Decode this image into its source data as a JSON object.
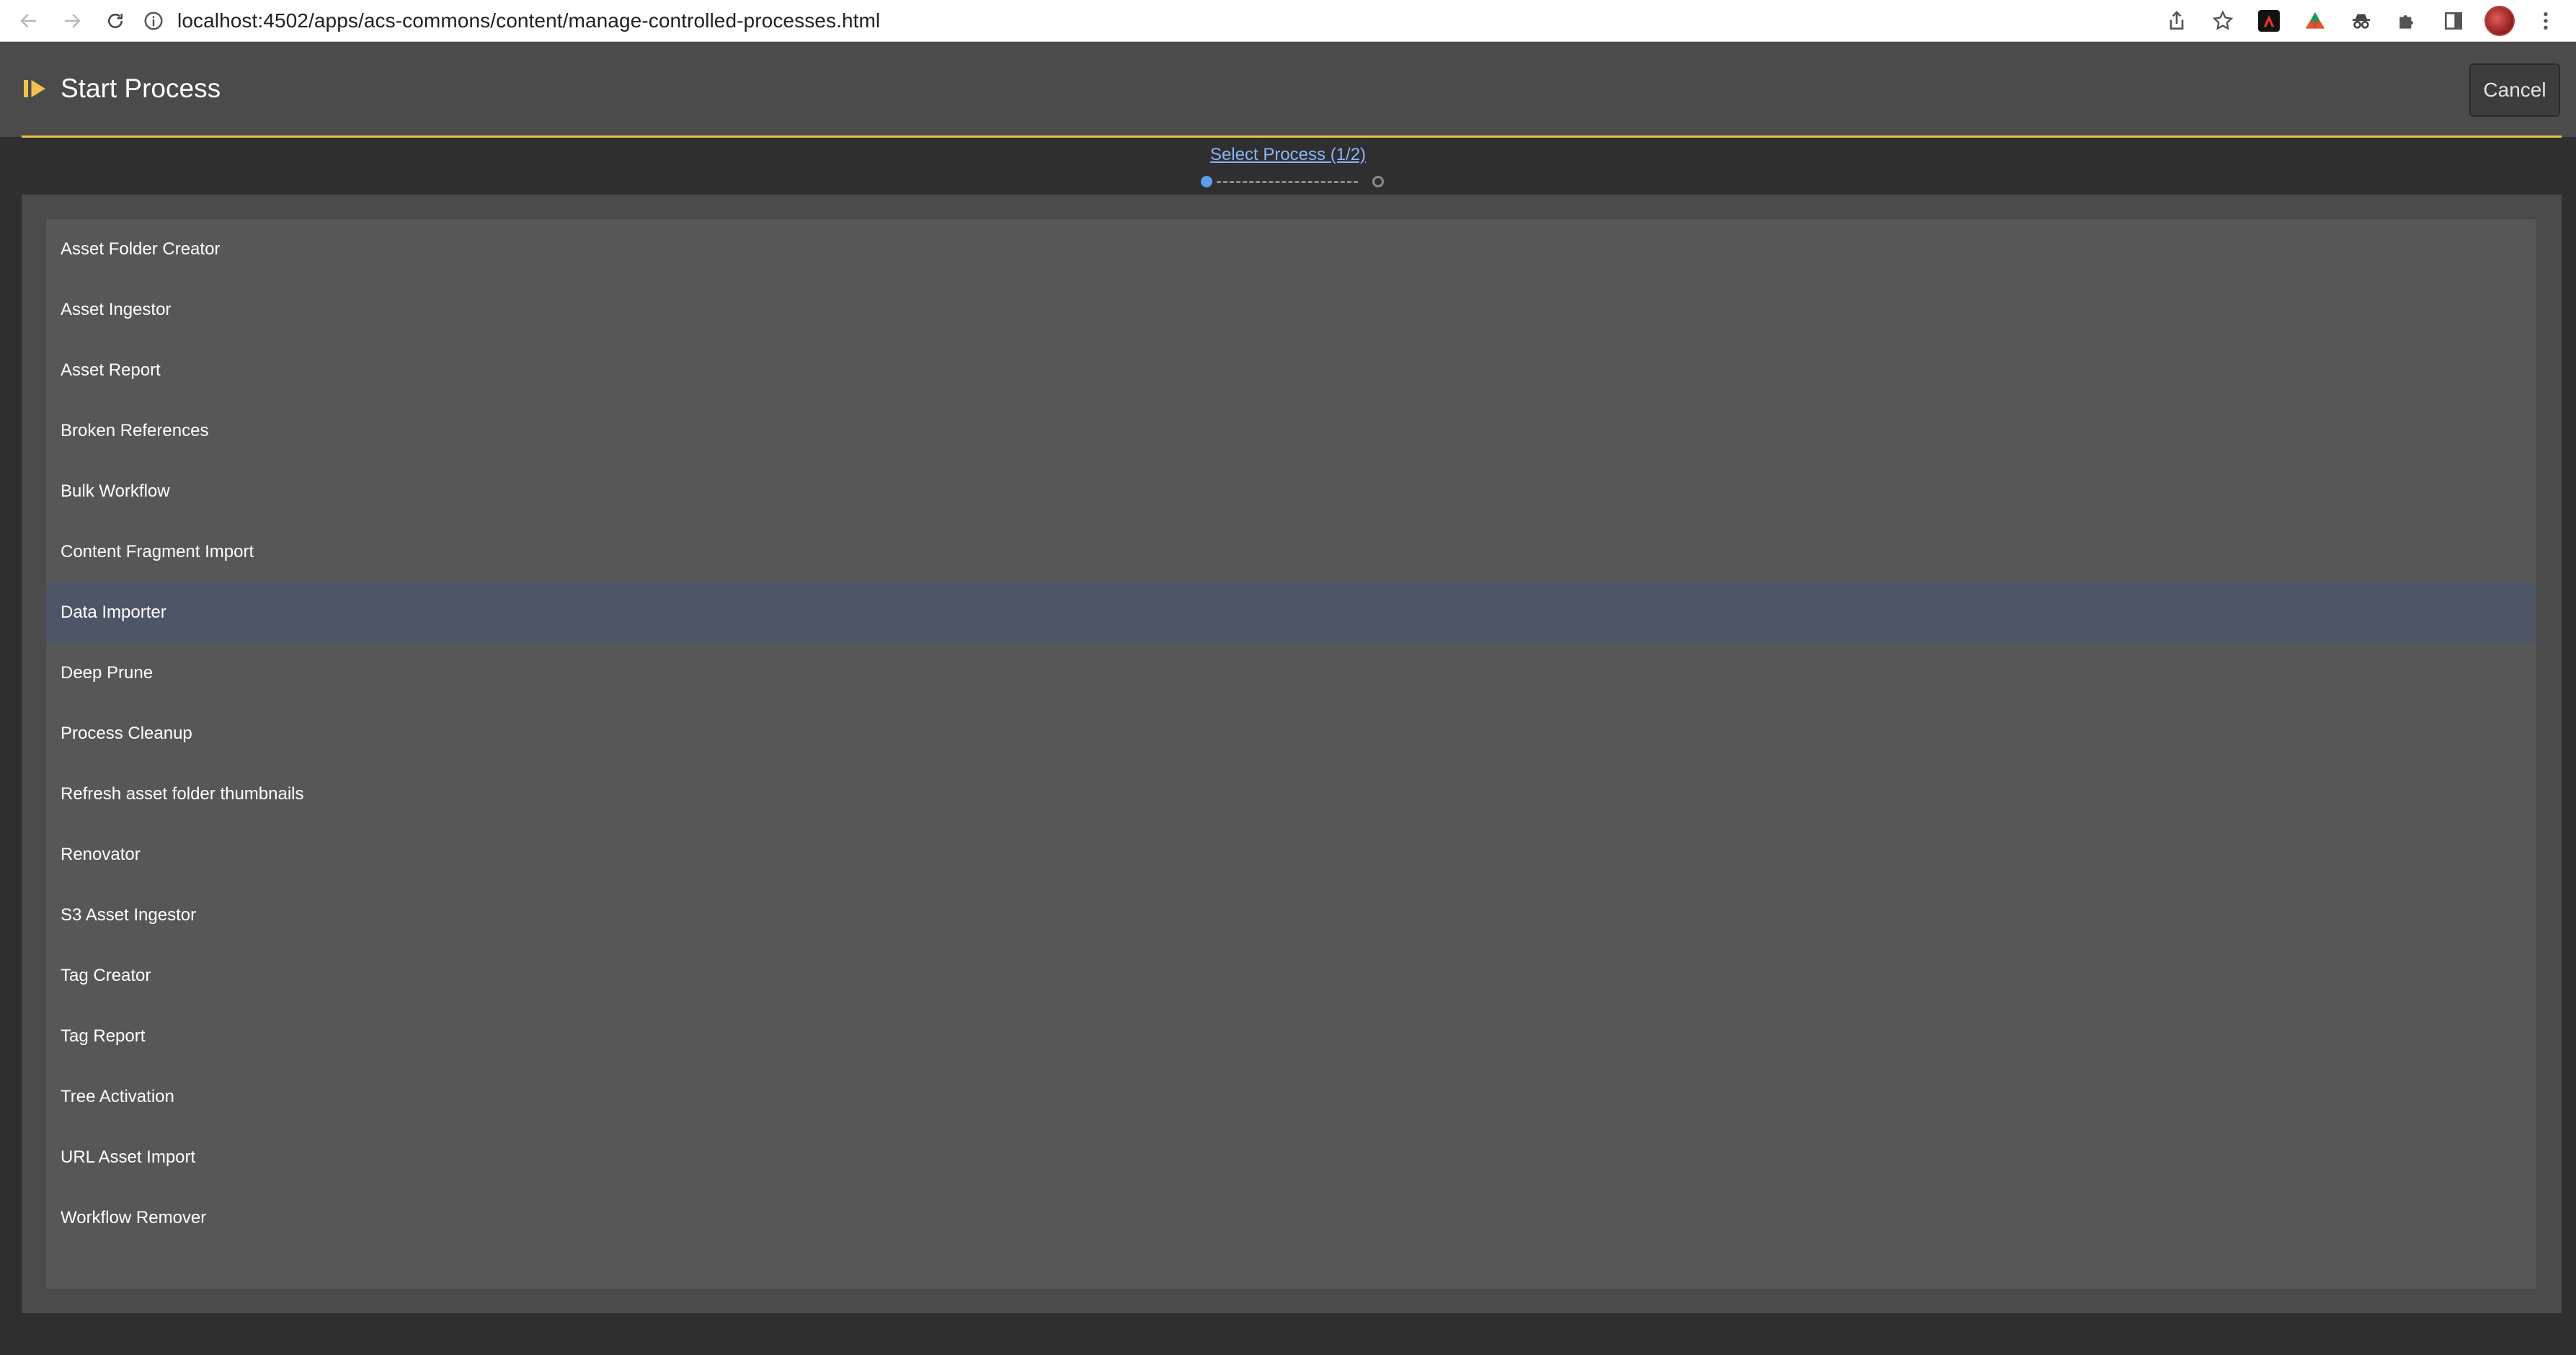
{
  "browser": {
    "url": "localhost:4502/apps/acs-commons/content/manage-controlled-processes.html"
  },
  "dialog": {
    "title": "Start Process",
    "cancel_label": "Cancel",
    "accent_color": "#f2c14e",
    "step_label": "Select Process (1/2)",
    "current_step": 1,
    "total_steps": 2
  },
  "processes": [
    "Asset Folder Creator",
    "Asset Ingestor",
    "Asset Report",
    "Broken References",
    "Bulk Workflow",
    "Content Fragment Import",
    "Data Importer",
    "Deep Prune",
    "Process Cleanup",
    "Refresh asset folder thumbnails",
    "Renovator",
    "S3 Asset Ingestor",
    "Tag Creator",
    "Tag Report",
    "Tree Activation",
    "URL Asset Import",
    "Workflow Remover"
  ],
  "selected_process": "Data Importer",
  "icons": {
    "back": "arrow-left-icon",
    "forward": "arrow-right-icon",
    "reload": "reload-icon",
    "site_info": "info-icon",
    "share": "share-icon",
    "bookmark": "star-icon",
    "extensions": "puzzle-icon",
    "side_panel": "side-panel-icon",
    "menu": "kebab-menu-icon",
    "title": "play-step-icon"
  }
}
